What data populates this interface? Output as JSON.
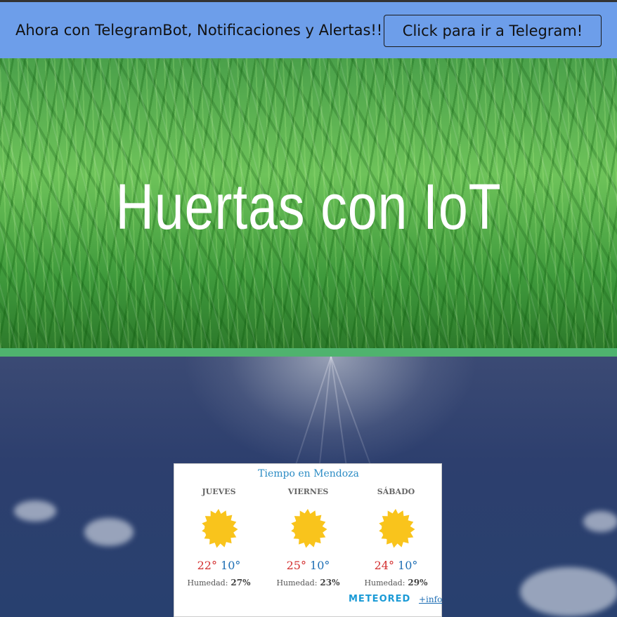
{
  "banner": {
    "text": "Ahora con TelegramBot, Notificaciones y Alertas!!",
    "button_label": "Click para ir a Telegram!"
  },
  "hero": {
    "title": "Huertas con IoT"
  },
  "weather": {
    "title": "Tiempo en Mendoza",
    "days": [
      {
        "name": "JUEVES",
        "max": "22°",
        "min": "10°",
        "humidity_label": "Humedad:",
        "humidity": "27%",
        "icon": "sun-icon"
      },
      {
        "name": "VIERNES",
        "max": "25°",
        "min": "10°",
        "humidity_label": "Humedad:",
        "humidity": "23%",
        "icon": "sun-icon"
      },
      {
        "name": "SÁBADO",
        "max": "24°",
        "min": "10°",
        "humidity_label": "Humedad:",
        "humidity": "29%",
        "icon": "sun-icon"
      }
    ],
    "logo": "METEORED",
    "more_link": "+info"
  },
  "colors": {
    "banner_bg": "#6d9eea",
    "accent_green": "#4fb36e",
    "max_temp": "#d32f2f",
    "min_temp": "#1f6fb5",
    "sun": "#f9c41c"
  }
}
